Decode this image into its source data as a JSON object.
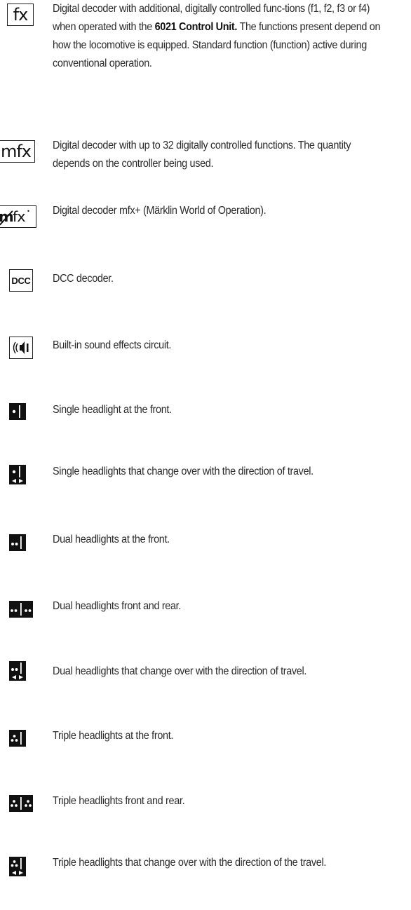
{
  "items": [
    {
      "icon": "fx-logo-icon",
      "icon_text": "fx",
      "text_before": "Digital decoder with additional, digitally controlled func-tions (f1, f2, f3 or f4) when operated with the ",
      "text_bold": "6021 Control Unit.",
      "text_after": " The functions present depend on how the locomotive is equipped. Standard function (function) active during conventional operation."
    },
    {
      "icon": "mfx-logo-icon",
      "icon_text": "mfx",
      "text": "Digital decoder with up to 32 digitally controlled functions. The quantity depends on the controller being used."
    },
    {
      "icon": "mfx-plus-logo-icon",
      "icon_text": "mfx",
      "text": "Digital decoder mfx+ (Märklin World of Operation)."
    },
    {
      "icon": "dcc-logo-icon",
      "icon_text": "DCC",
      "text": "DCC decoder."
    },
    {
      "icon": "sound-icon",
      "text": "Built-in sound effects circuit."
    },
    {
      "icon": "single-headlight-icon",
      "text": "Single headlight at the front."
    },
    {
      "icon": "single-headlight-change-icon",
      "text": "Single headlights that change over with the direction of travel."
    },
    {
      "icon": "dual-headlight-icon",
      "text": "Dual headlights at the front."
    },
    {
      "icon": "dual-headlight-front-rear-icon",
      "text": "Dual headlights front and rear."
    },
    {
      "icon": "dual-headlight-change-icon",
      "text": "Dual headlights that change over with the direction of travel."
    },
    {
      "icon": "triple-headlight-icon",
      "text": "Triple headlights at the front."
    },
    {
      "icon": "triple-headlight-front-rear-icon",
      "text": "Triple headlights front and rear."
    },
    {
      "icon": "triple-headlight-change-icon",
      "text": "Triple headlights that change over with the direction of the travel."
    }
  ]
}
